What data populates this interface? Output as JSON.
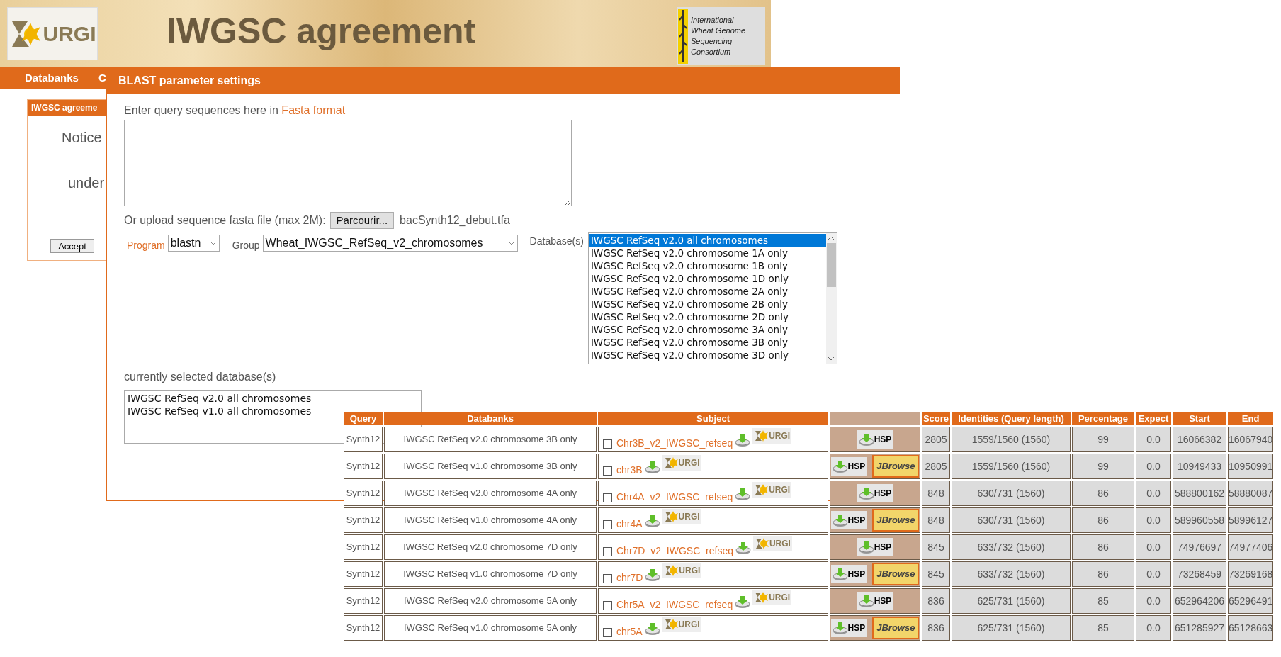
{
  "background_page": {
    "logo_text": "URGI",
    "title": "IWGSC agreement",
    "partner_logo_lines": [
      "International",
      "Wheat Genome",
      "Sequencing",
      "Consortium"
    ],
    "nav": [
      "Databanks",
      "C"
    ],
    "card": {
      "title": "IWGSC agreeme",
      "lines": [
        "Notice",
        "under"
      ],
      "button": "Accept"
    }
  },
  "blast_panel": {
    "title": "BLAST parameter settings",
    "query_prompt": "Enter query sequences here in ",
    "query_prompt_link": "Fasta format",
    "upload_label": "Or upload sequence fasta file (max 2M):",
    "browse_button": "Parcourir...",
    "file_name": "bacSynth12_debut.tfa",
    "program": {
      "label": "Program",
      "value": "blastn"
    },
    "group": {
      "label": "Group",
      "value": "Wheat_IWGSC_RefSeq_v2_chromosomes"
    },
    "databases": {
      "label": "Database(s)",
      "options": [
        {
          "label": "IWGSC RefSeq v2.0 all chromosomes",
          "selected": true
        },
        {
          "label": "IWGSC RefSeq v2.0 chromosome 1A only",
          "selected": false
        },
        {
          "label": "IWGSC RefSeq v2.0 chromosome 1B only",
          "selected": false
        },
        {
          "label": "IWGSC RefSeq v2.0 chromosome 1D only",
          "selected": false
        },
        {
          "label": "IWGSC RefSeq v2.0 chromosome 2A only",
          "selected": false
        },
        {
          "label": "IWGSC RefSeq v2.0 chromosome 2B only",
          "selected": false
        },
        {
          "label": "IWGSC RefSeq v2.0 chromosome 2D only",
          "selected": false
        },
        {
          "label": "IWGSC RefSeq v2.0 chromosome 3A only",
          "selected": false
        },
        {
          "label": "IWGSC RefSeq v2.0 chromosome 3B only",
          "selected": false
        },
        {
          "label": "IWGSC RefSeq v2.0 chromosome 3D only",
          "selected": false
        }
      ]
    },
    "selected_label": "currently selected database(s)",
    "selected_databases": [
      "IWGSC RefSeq v2.0 all chromosomes",
      "IWGSC RefSeq v1.0 all chromosomes"
    ]
  },
  "results": {
    "columns": [
      "Query",
      "Databanks",
      "Subject",
      "Score",
      "Identities (Query length)",
      "Percentage",
      "Expect",
      "Start",
      "End"
    ],
    "rows": [
      {
        "query": "Synth12",
        "databank": "IWGSC RefSeq v2.0 chromosome 3B only",
        "subject": "Chr3B_v2_IWGSC_refseq",
        "checked": false,
        "logo": "URGI",
        "hsp": "HSP",
        "score": "2805",
        "identities": "1559/1560 (1560)",
        "percentage": "99",
        "expect": "0.0",
        "start": "16066382",
        "end": "16067940"
      },
      {
        "query": "Synth12",
        "databank": "IWGSC RefSeq v1.0 chromosome 3B only",
        "subject": "chr3B",
        "checked": false,
        "logo": "URGI",
        "hsp": "HSP",
        "jbrowse": "JBrowse",
        "score": "2805",
        "identities": "1559/1560 (1560)",
        "percentage": "99",
        "expect": "0.0",
        "start": "10949433",
        "end": "10950991"
      },
      {
        "query": "Synth12",
        "databank": "IWGSC RefSeq v2.0 chromosome 4A only",
        "subject": "Chr4A_v2_IWGSC_refseq",
        "checked": false,
        "logo": "URGI",
        "hsp": "HSP",
        "score": "848",
        "identities": "630/731 (1560)",
        "percentage": "86",
        "expect": "0.0",
        "start": "588800162",
        "end": "58880087"
      },
      {
        "query": "Synth12",
        "databank": "IWGSC RefSeq v1.0 chromosome 4A only",
        "subject": "chr4A",
        "checked": false,
        "logo": "URGI",
        "hsp": "HSP",
        "jbrowse": "JBrowse",
        "score": "848",
        "identities": "630/731 (1560)",
        "percentage": "86",
        "expect": "0.0",
        "start": "589960558",
        "end": "58996127"
      },
      {
        "query": "Synth12",
        "databank": "IWGSC RefSeq v2.0 chromosome 7D only",
        "subject": "Chr7D_v2_IWGSC_refseq",
        "checked": false,
        "logo": "URGI",
        "hsp": "HSP",
        "score": "845",
        "identities": "633/732 (1560)",
        "percentage": "86",
        "expect": "0.0",
        "start": "74976697",
        "end": "74977406"
      },
      {
        "query": "Synth12",
        "databank": "IWGSC RefSeq v1.0 chromosome 7D only",
        "subject": "chr7D",
        "checked": false,
        "logo": "URGI",
        "hsp": "HSP",
        "jbrowse": "JBrowse",
        "score": "845",
        "identities": "633/732 (1560)",
        "percentage": "86",
        "expect": "0.0",
        "start": "73268459",
        "end": "73269168"
      },
      {
        "query": "Synth12",
        "databank": "IWGSC RefSeq v2.0 chromosome 5A only",
        "subject": "Chr5A_v2_IWGSC_refseq",
        "checked": false,
        "logo": "URGI",
        "hsp": "HSP",
        "score": "836",
        "identities": "625/731 (1560)",
        "percentage": "85",
        "expect": "0.0",
        "start": "652964206",
        "end": "65296491"
      },
      {
        "query": "Synth12",
        "databank": "IWGSC RefSeq v1.0 chromosome 5A only",
        "subject": "chr5A",
        "checked": false,
        "logo": "URGI",
        "hsp": "HSP",
        "jbrowse": "JBrowse",
        "score": "836",
        "identities": "625/731 (1560)",
        "percentage": "85",
        "expect": "0.0",
        "start": "651285927",
        "end": "65128663"
      }
    ]
  }
}
